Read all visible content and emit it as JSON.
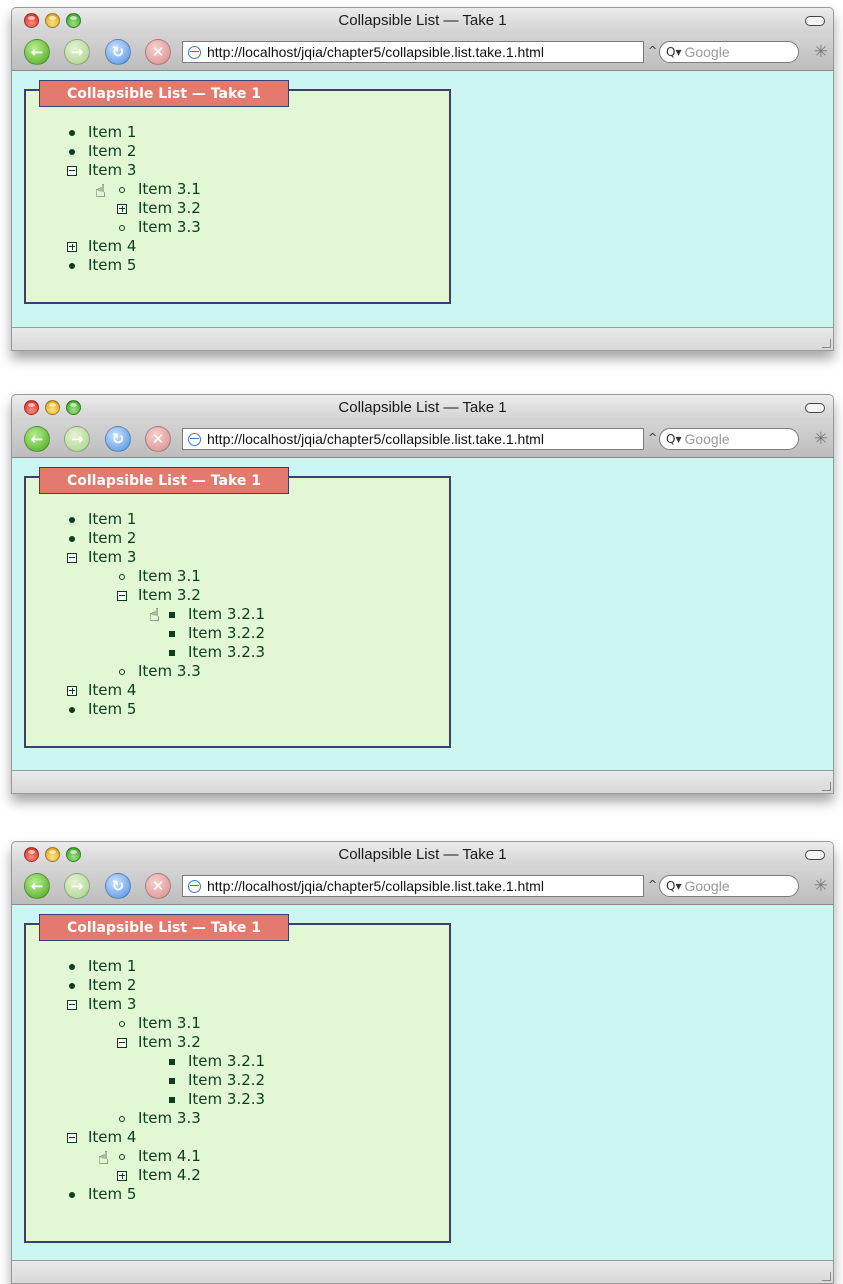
{
  "windows": [
    {
      "title": "Collapsible List — Take 1",
      "url": "http://localhost/jqia/chapter5/collapsible.list.take.1.html",
      "search_placeholder": "Google",
      "legend": "Collapsible List — Take 1",
      "items": [
        {
          "label": "Item 1",
          "marker": "disc",
          "level": 0
        },
        {
          "label": "Item 2",
          "marker": "disc",
          "level": 0
        },
        {
          "label": "Item 3",
          "marker": "minus",
          "level": 0
        },
        {
          "label": "Item 3.1",
          "marker": "circle",
          "level": 1
        },
        {
          "label": "Item 3.2",
          "marker": "plus",
          "level": 1
        },
        {
          "label": "Item 3.3",
          "marker": "circle",
          "level": 1
        },
        {
          "label": "Item 4",
          "marker": "plus",
          "level": 0
        },
        {
          "label": "Item 5",
          "marker": "disc",
          "level": 0
        }
      ]
    },
    {
      "title": "Collapsible List — Take 1",
      "url": "http://localhost/jqia/chapter5/collapsible.list.take.1.html",
      "search_placeholder": "Google",
      "legend": "Collapsible List — Take 1",
      "items": [
        {
          "label": "Item 1",
          "marker": "disc",
          "level": 0
        },
        {
          "label": "Item 2",
          "marker": "disc",
          "level": 0
        },
        {
          "label": "Item 3",
          "marker": "minus",
          "level": 0
        },
        {
          "label": "Item 3.1",
          "marker": "circle",
          "level": 1
        },
        {
          "label": "Item 3.2",
          "marker": "minus",
          "level": 1
        },
        {
          "label": "Item 3.2.1",
          "marker": "square",
          "level": 2
        },
        {
          "label": "Item 3.2.2",
          "marker": "square",
          "level": 2
        },
        {
          "label": "Item 3.2.3",
          "marker": "square",
          "level": 2
        },
        {
          "label": "Item 3.3",
          "marker": "circle",
          "level": 1
        },
        {
          "label": "Item 4",
          "marker": "plus",
          "level": 0
        },
        {
          "label": "Item 5",
          "marker": "disc",
          "level": 0
        }
      ]
    },
    {
      "title": "Collapsible List — Take 1",
      "url": "http://localhost/jqia/chapter5/collapsible.list.take.1.html",
      "search_placeholder": "Google",
      "legend": "Collapsible List — Take 1",
      "items": [
        {
          "label": "Item 1",
          "marker": "disc",
          "level": 0
        },
        {
          "label": "Item 2",
          "marker": "disc",
          "level": 0
        },
        {
          "label": "Item 3",
          "marker": "minus",
          "level": 0
        },
        {
          "label": "Item 3.1",
          "marker": "circle",
          "level": 1
        },
        {
          "label": "Item 3.2",
          "marker": "minus",
          "level": 1
        },
        {
          "label": "Item 3.2.1",
          "marker": "square",
          "level": 2
        },
        {
          "label": "Item 3.2.2",
          "marker": "square",
          "level": 2
        },
        {
          "label": "Item 3.2.3",
          "marker": "square",
          "level": 2
        },
        {
          "label": "Item 3.3",
          "marker": "circle",
          "level": 1
        },
        {
          "label": "Item 4",
          "marker": "minus",
          "level": 0
        },
        {
          "label": "Item 4.1",
          "marker": "circle",
          "level": 1
        },
        {
          "label": "Item 4.2",
          "marker": "plus",
          "level": 1
        },
        {
          "label": "Item 5",
          "marker": "disc",
          "level": 0
        }
      ]
    }
  ],
  "icons": {
    "back": "left-arrow-icon",
    "forward": "right-arrow-icon",
    "reload": "reload-icon",
    "stop": "stop-icon",
    "search": "search-icon",
    "activity": "activity-spinner-icon",
    "cursor": "pointer-hand-icon"
  },
  "colors": {
    "page_background": "#ccf6f1",
    "fieldset_background": "#e2f8d5",
    "fieldset_border": "#3d3f6e",
    "legend_background": "#e47a6d",
    "legend_text": "#ffffff",
    "item_text": "#0c3d1d"
  }
}
